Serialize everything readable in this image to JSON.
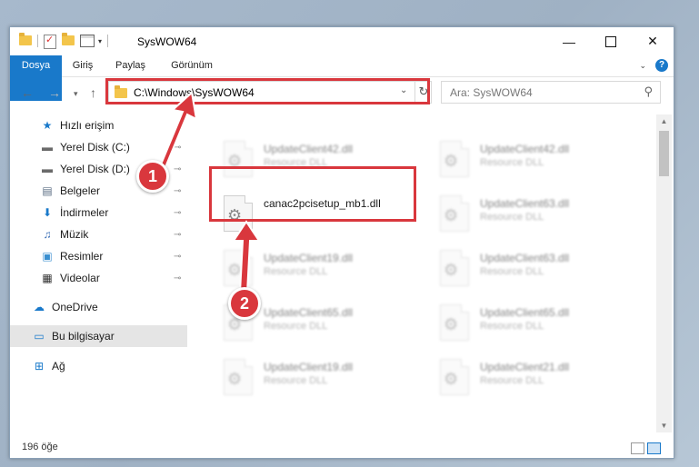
{
  "window": {
    "title": "SysWOW64",
    "min_symbol": "—",
    "close_symbol": "✕"
  },
  "ribbon": {
    "tabs": [
      "Dosya",
      "Giriş",
      "Paylaş",
      "Görünüm"
    ],
    "help_symbol": "?",
    "collapse_symbol": "⌄"
  },
  "nav": {
    "back_symbol": "←",
    "forward_symbol": "→",
    "recent_symbol": "▾",
    "up_symbol": "↑",
    "address": "C:\\Windows\\SysWOW64",
    "address_dropdown_symbol": "⌄",
    "refresh_symbol": "↻",
    "search_placeholder": "Ara: SysWOW64",
    "search_symbol": "⚲"
  },
  "sidebar": {
    "items": [
      {
        "label": "Hızlı erişim",
        "icon": "star-icon",
        "glyph": "★",
        "color": "#1979ca",
        "pinned": false
      },
      {
        "label": "Yerel Disk (C:)",
        "icon": "drive-icon",
        "glyph": "▬",
        "color": "#6a6a6a",
        "pinned": true
      },
      {
        "label": "Yerel Disk (D:)",
        "icon": "drive-icon",
        "glyph": "▬",
        "color": "#6a6a6a",
        "pinned": true
      },
      {
        "label": "Belgeler",
        "icon": "document-icon",
        "glyph": "▤",
        "color": "#5c6f85",
        "pinned": true
      },
      {
        "label": "İndirmeler",
        "icon": "download-icon",
        "glyph": "⬇",
        "color": "#1979ca",
        "pinned": true
      },
      {
        "label": "Müzik",
        "icon": "music-icon",
        "glyph": "♫",
        "color": "#3b6fb6",
        "pinned": true
      },
      {
        "label": "Resimler",
        "icon": "pictures-icon",
        "glyph": "▣",
        "color": "#3a8fd0",
        "pinned": true
      },
      {
        "label": "Videolar",
        "icon": "video-icon",
        "glyph": "▦",
        "color": "#333333",
        "pinned": true
      },
      {
        "label": "OneDrive",
        "icon": "cloud-icon",
        "glyph": "☁",
        "color": "#1979ca",
        "pinned": false
      },
      {
        "label": "Bu bilgisayar",
        "icon": "computer-icon",
        "glyph": "▭",
        "color": "#1979ca",
        "pinned": false
      },
      {
        "label": "Ağ",
        "icon": "network-icon",
        "glyph": "⊞",
        "color": "#1979ca",
        "pinned": false
      }
    ],
    "pin_symbol": "📌"
  },
  "files": [
    {
      "name": "UpdateClient42.dll",
      "type": "Resource DLL",
      "blurred": true
    },
    {
      "name": "UpdateClient42.dll",
      "type": "Resource DLL",
      "blurred": true
    },
    {
      "name": "canac2pcisetup_mb1.dll",
      "type": "",
      "blurred": false
    },
    {
      "name": "UpdateClient63.dll",
      "type": "Resource DLL",
      "blurred": true
    },
    {
      "name": "UpdateClient19.dll",
      "type": "Resource DLL",
      "blurred": true
    },
    {
      "name": "UpdateClient63.dll",
      "type": "Resource DLL",
      "blurred": true
    },
    {
      "name": "UpdateClient65.dll",
      "type": "Resource DLL",
      "blurred": true
    },
    {
      "name": "UpdateClient65.dll",
      "type": "Resource DLL",
      "blurred": true
    },
    {
      "name": "UpdateClient19.dll",
      "type": "Resource DLL",
      "blurred": true
    },
    {
      "name": "UpdateClient21.dll",
      "type": "Resource DLL",
      "blurred": true
    }
  ],
  "status": {
    "item_count": "196 öğe"
  },
  "annotations": {
    "one": "1",
    "two": "2",
    "color": "#d9373d"
  }
}
